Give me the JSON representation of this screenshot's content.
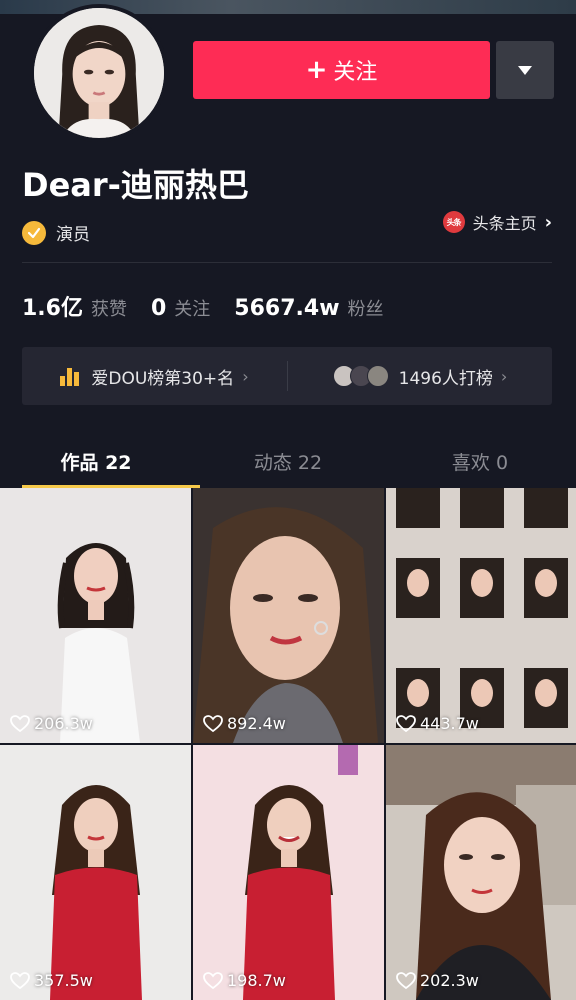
{
  "profile": {
    "name": "Dear-迪丽热巴",
    "role": "演员",
    "follow_label": "关注",
    "toutiao_badge": "头条",
    "toutiao_label": "头条主页"
  },
  "stats": {
    "likes_value": "1.6亿",
    "likes_label": "获赞",
    "following_value": "0",
    "following_label": "关注",
    "followers_value": "5667.4w",
    "followers_label": "粉丝"
  },
  "rank": {
    "left_label": "爱DOU榜第30+名",
    "right_label": "1496人打榜"
  },
  "tabs": [
    {
      "label": "作品 22",
      "active": true
    },
    {
      "label": "动态 22",
      "active": false
    },
    {
      "label": "喜欢 0",
      "active": false
    }
  ],
  "videos": [
    {
      "likes": "206.3w"
    },
    {
      "likes": "892.4w"
    },
    {
      "likes": "443.7w"
    },
    {
      "likes": "357.5w"
    },
    {
      "likes": "198.7w"
    },
    {
      "likes": "202.3w"
    }
  ],
  "colors": {
    "background": "#161823",
    "follow_button": "#fe2c55",
    "accent_yellow": "#f6c94a",
    "toutiao_red": "#e03a3e"
  }
}
